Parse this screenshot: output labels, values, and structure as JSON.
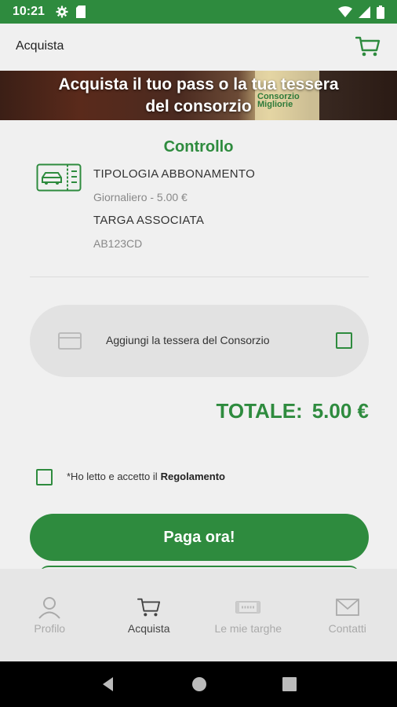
{
  "status_bar": {
    "time": "10:21",
    "icons": [
      "gear-icon",
      "sim-card-icon",
      "wifi-icon",
      "signal-icon",
      "battery-icon"
    ]
  },
  "app_bar": {
    "title": "Acquista",
    "icon": "cart-icon"
  },
  "banner": {
    "line1": "Acquista il tuo pass o la tua tessera",
    "line2": "del consorzio",
    "background_text": "Consorzio Migliorie"
  },
  "summary": {
    "title": "Controllo",
    "subscription_type_label": "TIPOLOGIA ABBONAMENTO",
    "subscription_type_value": "Giornaliero - 5.00 €",
    "plate_label": "TARGA ASSOCIATA",
    "plate_value": "AB123CD"
  },
  "tessera": {
    "label": "Aggiungi la tessera del Consorzio",
    "checked": false
  },
  "total": {
    "label": "TOTALE:",
    "amount": "5.00 €"
  },
  "regulation": {
    "text": "*Ho letto e accetto il",
    "link": "Regolamento",
    "checked": false
  },
  "pay_button": {
    "label": "Paga ora!"
  },
  "bottom_nav": {
    "items": [
      {
        "label": "Profilo",
        "icon": "person-icon",
        "active": false
      },
      {
        "label": "Acquista",
        "icon": "cart-icon",
        "active": true
      },
      {
        "label": "Le mie targhe",
        "icon": "license-plate-icon",
        "active": false
      },
      {
        "label": "Contatti",
        "icon": "mail-icon",
        "active": false
      }
    ]
  },
  "colors": {
    "primary": "#2e8b3e",
    "background": "#f0f0f0",
    "nav_background": "#e6e6e6"
  }
}
